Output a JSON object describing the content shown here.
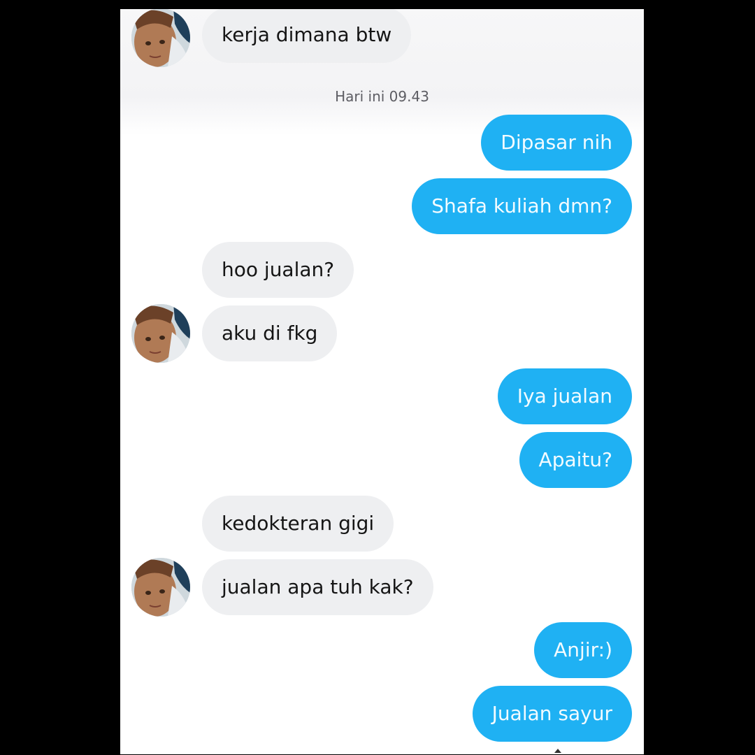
{
  "chat": {
    "timestamp": "Hari ini 09.43",
    "messages": [
      {
        "from": "them",
        "text": "kerja dimana btw"
      },
      {
        "from": "me",
        "text": "Dipasar nih"
      },
      {
        "from": "me",
        "text": "Shafa kuliah dmn?"
      },
      {
        "from": "them",
        "text": "hoo jualan?"
      },
      {
        "from": "them",
        "text": "aku di fkg"
      },
      {
        "from": "me",
        "text": "Iya jualan"
      },
      {
        "from": "me",
        "text": "Apaitu?"
      },
      {
        "from": "them",
        "text": "kedokteran gigi"
      },
      {
        "from": "them",
        "text": "jualan apa tuh kak?"
      },
      {
        "from": "me",
        "text": "Anjir:)"
      },
      {
        "from": "me",
        "text": "Jualan sayur"
      }
    ]
  },
  "colors": {
    "outgoing_bubble": "#1fb1f3",
    "incoming_bubble": "#eeeff1",
    "background": "#ffffff"
  }
}
